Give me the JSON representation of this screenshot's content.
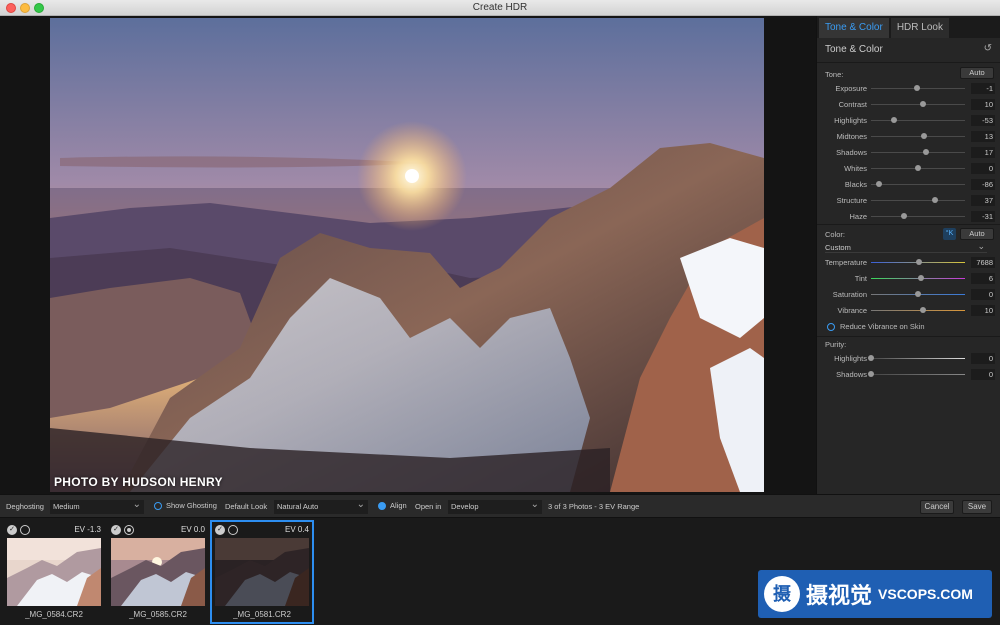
{
  "window": {
    "title": "Create HDR"
  },
  "photo": {
    "credit": "PHOTO BY HUDSON HENRY"
  },
  "panel": {
    "tabs": [
      {
        "label": "Tone & Color",
        "active": true
      },
      {
        "label": "HDR Look",
        "active": false
      }
    ],
    "section_title": "Tone & Color",
    "tone": {
      "label": "Tone:",
      "auto_label": "Auto",
      "sliders": [
        {
          "label": "Exposure",
          "value": "-1",
          "pos": 0.49
        },
        {
          "label": "Contrast",
          "value": "10",
          "pos": 0.55
        },
        {
          "label": "Highlights",
          "value": "-53",
          "pos": 0.24
        },
        {
          "label": "Midtones",
          "value": "13",
          "pos": 0.56
        },
        {
          "label": "Shadows",
          "value": "17",
          "pos": 0.58
        },
        {
          "label": "Whites",
          "value": "0",
          "pos": 0.5
        },
        {
          "label": "Blacks",
          "value": "-86",
          "pos": 0.08
        },
        {
          "label": "Structure",
          "value": "37",
          "pos": 0.68
        },
        {
          "label": "Haze",
          "value": "-31",
          "pos": 0.35
        }
      ]
    },
    "color": {
      "label": "Color:",
      "wb_icon": "°K",
      "auto_label": "Auto",
      "preset": "Custom",
      "sliders": [
        {
          "label": "Temperature",
          "value": "7688",
          "pos": 0.51,
          "track": "linear-gradient(90deg,#3a5fd8,#d8c53a)"
        },
        {
          "label": "Tint",
          "value": "6",
          "pos": 0.53,
          "track": "linear-gradient(90deg,#3ad85a,#c83ad8)"
        },
        {
          "label": "Saturation",
          "value": "0",
          "pos": 0.5,
          "track": "linear-gradient(90deg,#777,#3a7ad8)"
        },
        {
          "label": "Vibrance",
          "value": "10",
          "pos": 0.55,
          "track": "linear-gradient(90deg,#777,#d8963a)"
        }
      ],
      "reduce_vibrance_label": "Reduce Vibrance on Skin"
    },
    "purity": {
      "label": "Purity:",
      "sliders": [
        {
          "label": "Highlights",
          "value": "0",
          "pos": 0.0,
          "track": "linear-gradient(90deg,#444,#ddd)"
        },
        {
          "label": "Shadows",
          "value": "0",
          "pos": 0.0,
          "track": "linear-gradient(90deg,#444,#888)"
        }
      ]
    }
  },
  "toolbar": {
    "deghosting_label": "Deghosting",
    "deghosting_value": "Medium",
    "show_ghosting_label": "Show Ghosting",
    "default_look_label": "Default Look",
    "default_look_value": "Natural Auto",
    "align_label": "Align",
    "open_in_label": "Open in",
    "open_in_value": "Develop",
    "photo_count": "3 of 3 Photos - 3 EV Range",
    "cancel_label": "Cancel",
    "save_label": "Save"
  },
  "filmstrip": [
    {
      "ev": "EV -1.3",
      "filename": "_MG_0584.CR2",
      "selected": false,
      "primary": false
    },
    {
      "ev": "EV 0.0",
      "filename": "_MG_0585.CR2",
      "selected": false,
      "primary": true
    },
    {
      "ev": "EV 0.4",
      "filename": "_MG_0581.CR2",
      "selected": true,
      "primary": false
    }
  ],
  "watermark": {
    "logo": "摄",
    "cn": "摄视觉",
    "en": "VSCOPS.COM"
  },
  "colors": {
    "accent": "#3a9cf3",
    "selection": "#2d8ef0",
    "panel": "#262626"
  }
}
